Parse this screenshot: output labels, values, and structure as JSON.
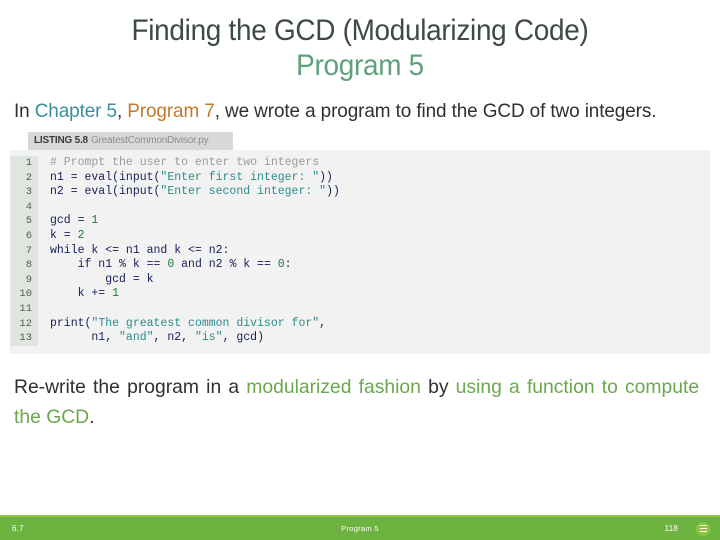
{
  "slide": {
    "title_line1": "Finding the GCD (Modularizing Code)",
    "title_line2": "Program 5",
    "intro": {
      "part1": "In ",
      "chapter_ref": "Chapter 5",
      "part2": ", ",
      "program_ref": "Program 7",
      "part3": ", we wrote a program to find the GCD of two integers."
    },
    "listing": {
      "label": "LISTING 5.8",
      "filename": "GreatestCommonDivisor.py",
      "line_numbers": [
        "1",
        "2",
        "3",
        "4",
        "5",
        "6",
        "7",
        "8",
        "9",
        "10",
        "11",
        "12",
        "13"
      ],
      "lines": [
        {
          "n": "1",
          "segments": [
            {
              "t": "# Prompt the user to enter two integers",
              "c": "comment"
            }
          ]
        },
        {
          "n": "2",
          "segments": [
            {
              "t": "n1 = eval(input(",
              "c": "plain"
            },
            {
              "t": "\"Enter first integer: \"",
              "c": "string"
            },
            {
              "t": "))",
              "c": "plain"
            }
          ]
        },
        {
          "n": "3",
          "segments": [
            {
              "t": "n2 = eval(input(",
              "c": "plain"
            },
            {
              "t": "\"Enter second integer: \"",
              "c": "string"
            },
            {
              "t": "))",
              "c": "plain"
            }
          ]
        },
        {
          "n": "4",
          "segments": [
            {
              "t": "",
              "c": "plain"
            }
          ]
        },
        {
          "n": "5",
          "segments": [
            {
              "t": "gcd = ",
              "c": "plain"
            },
            {
              "t": "1",
              "c": "num"
            }
          ]
        },
        {
          "n": "6",
          "segments": [
            {
              "t": "k = ",
              "c": "plain"
            },
            {
              "t": "2",
              "c": "num"
            }
          ]
        },
        {
          "n": "7",
          "segments": [
            {
              "t": "while k <= n1 and k <= n2:",
              "c": "plain"
            }
          ]
        },
        {
          "n": "8",
          "segments": [
            {
              "t": "    if n1 % k == ",
              "c": "plain"
            },
            {
              "t": "0",
              "c": "num"
            },
            {
              "t": " and n2 % k == ",
              "c": "plain"
            },
            {
              "t": "0",
              "c": "num"
            },
            {
              "t": ":",
              "c": "plain"
            }
          ]
        },
        {
          "n": "9",
          "segments": [
            {
              "t": "        gcd = k",
              "c": "plain"
            }
          ]
        },
        {
          "n": "10",
          "segments": [
            {
              "t": "    k += ",
              "c": "plain"
            },
            {
              "t": "1",
              "c": "num"
            }
          ]
        },
        {
          "n": "11",
          "segments": [
            {
              "t": "",
              "c": "plain"
            }
          ]
        },
        {
          "n": "12",
          "segments": [
            {
              "t": "print(",
              "c": "plain"
            },
            {
              "t": "\"The greatest common divisor for\"",
              "c": "string"
            },
            {
              "t": ",",
              "c": "plain"
            }
          ]
        },
        {
          "n": "13",
          "segments": [
            {
              "t": "      n1, ",
              "c": "plain"
            },
            {
              "t": "\"and\"",
              "c": "string"
            },
            {
              "t": ", n2, ",
              "c": "plain"
            },
            {
              "t": "\"is\"",
              "c": "string"
            },
            {
              "t": ", gcd)",
              "c": "plain"
            }
          ]
        }
      ]
    },
    "closing": {
      "p1": "Re-write the program in a ",
      "g1": "modularized fashion",
      "p2": " by ",
      "g2": "using a function to compute the GCD",
      "p3": "."
    }
  },
  "footer": {
    "left": "6.7",
    "center": "Program 5",
    "right": "118",
    "icon": "menu-circle-icon"
  },
  "colors": {
    "title_dark": "#3d4b43",
    "title_green": "#5fa07d",
    "chapter_teal": "#3a8f9e",
    "program_orange": "#c07a28",
    "accent_green": "#6aa84f",
    "footer_green": "#6cb33f",
    "code_bg": "#f2f2f2",
    "gutter_bg": "#dfe6df",
    "string_teal": "#2e8b8b",
    "number_green": "#1f7a3a",
    "comment_gray": "#9b9b9b"
  }
}
